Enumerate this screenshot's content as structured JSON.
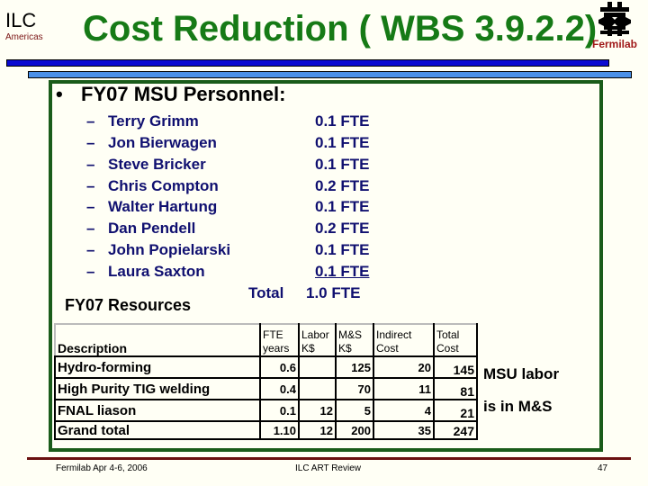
{
  "header": {
    "logo_left": {
      "main": "ILC",
      "sub": "Americas"
    },
    "title": "Cost Reduction ( WBS 3.9.2.2)",
    "logo_right": {
      "icon": "fermilab-logo-icon",
      "text": "Fermilab"
    }
  },
  "colors": {
    "title": "#167a16",
    "personnel_text": "#101070",
    "box_border": "#1a5c1a",
    "rule_dark_blue": "#0a0ad2",
    "rule_light_blue": "#4a90e8",
    "footer_rule": "#6a1010",
    "americas_text": "#7a1414",
    "fermilab_text": "#a01818"
  },
  "body": {
    "bullet": "•",
    "heading": "FY07 MSU Personnel:",
    "personnel": [
      {
        "name": "Terry Grimm",
        "fte": "0.1 FTE"
      },
      {
        "name": "Jon Bierwagen",
        "fte": "0.1 FTE"
      },
      {
        "name": "Steve Bricker",
        "fte": "0.1 FTE"
      },
      {
        "name": "Chris Compton",
        "fte": "0.2 FTE"
      },
      {
        "name": "Walter Hartung",
        "fte": "0.1 FTE"
      },
      {
        "name": "Dan Pendell",
        "fte": "0.2 FTE"
      },
      {
        "name": "John Popielarski",
        "fte": "0.1 FTE"
      },
      {
        "name": "Laura Saxton",
        "fte": "0.1 FTE"
      }
    ],
    "dash": "–",
    "total_label": "Total",
    "total_value": "1.0 FTE",
    "resources_label": "FY07 Resources",
    "note_line1": "MSU labor",
    "note_line2": "is in M&S"
  },
  "table": {
    "headers": {
      "description": "Description",
      "fte_1": "FTE",
      "fte_2": "years",
      "labor_1": "Labor",
      "labor_2": "K$",
      "ms_1": "M&S",
      "ms_2": "K$",
      "indirect_1": "Indirect",
      "indirect_2": "Cost",
      "total_1": "Total",
      "total_2": "Cost"
    },
    "rows": [
      {
        "description": "Hydro-forming",
        "fte": "0.6",
        "labor": "",
        "ms": "125",
        "indirect": "20",
        "total": "145"
      },
      {
        "description": "High Purity TIG welding",
        "fte": "0.4",
        "labor": "",
        "ms": "70",
        "indirect": "11",
        "total": "81"
      },
      {
        "description": "FNAL liason",
        "fte": "0.1",
        "labor": "12",
        "ms": "5",
        "indirect": "4",
        "total": "21"
      },
      {
        "description": "Grand total",
        "fte": "1.10",
        "labor": "12",
        "ms": "200",
        "indirect": "35",
        "total": "247"
      }
    ]
  },
  "footer": {
    "left": "Fermilab Apr 4-6, 2006",
    "center": "ILC ART Review",
    "page": "47"
  }
}
